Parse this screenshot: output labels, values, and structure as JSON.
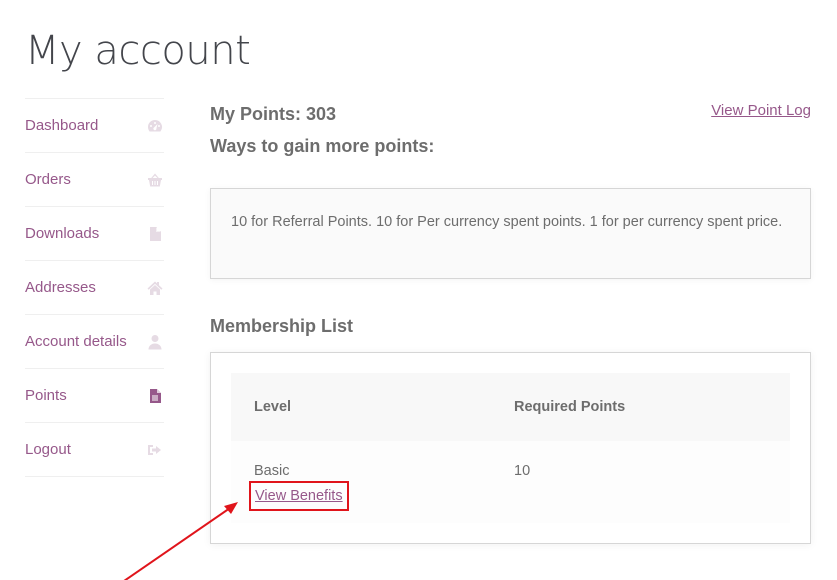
{
  "page": {
    "title": "My account"
  },
  "sidebar": {
    "items": [
      {
        "label": "Dashboard",
        "icon": "dashboard-gauge-icon",
        "active": false
      },
      {
        "label": "Orders",
        "icon": "basket-icon",
        "active": false
      },
      {
        "label": "Downloads",
        "icon": "file-icon",
        "active": false
      },
      {
        "label": "Addresses",
        "icon": "home-icon",
        "active": false
      },
      {
        "label": "Account details",
        "icon": "user-icon",
        "active": false
      },
      {
        "label": "Points",
        "icon": "document-icon",
        "active": true
      },
      {
        "label": "Logout",
        "icon": "sign-out-icon",
        "active": false
      }
    ]
  },
  "points": {
    "heading": "My Points: 303",
    "ways_heading": "Ways to gain more points:",
    "view_log_label": "View Point Log",
    "info_text": "10 for Referral Points. 10 for Per currency spent points. 1 for per currency spent price."
  },
  "membership": {
    "heading": "Membership List",
    "columns": [
      "Level",
      "Required Points"
    ],
    "rows": [
      {
        "level": "Basic",
        "required_points": "10",
        "link_label": "View Benefits"
      }
    ]
  },
  "colors": {
    "accent": "#96588a",
    "annotation": "#e0141b",
    "text": "#6d6d6d",
    "title": "#43454b"
  }
}
